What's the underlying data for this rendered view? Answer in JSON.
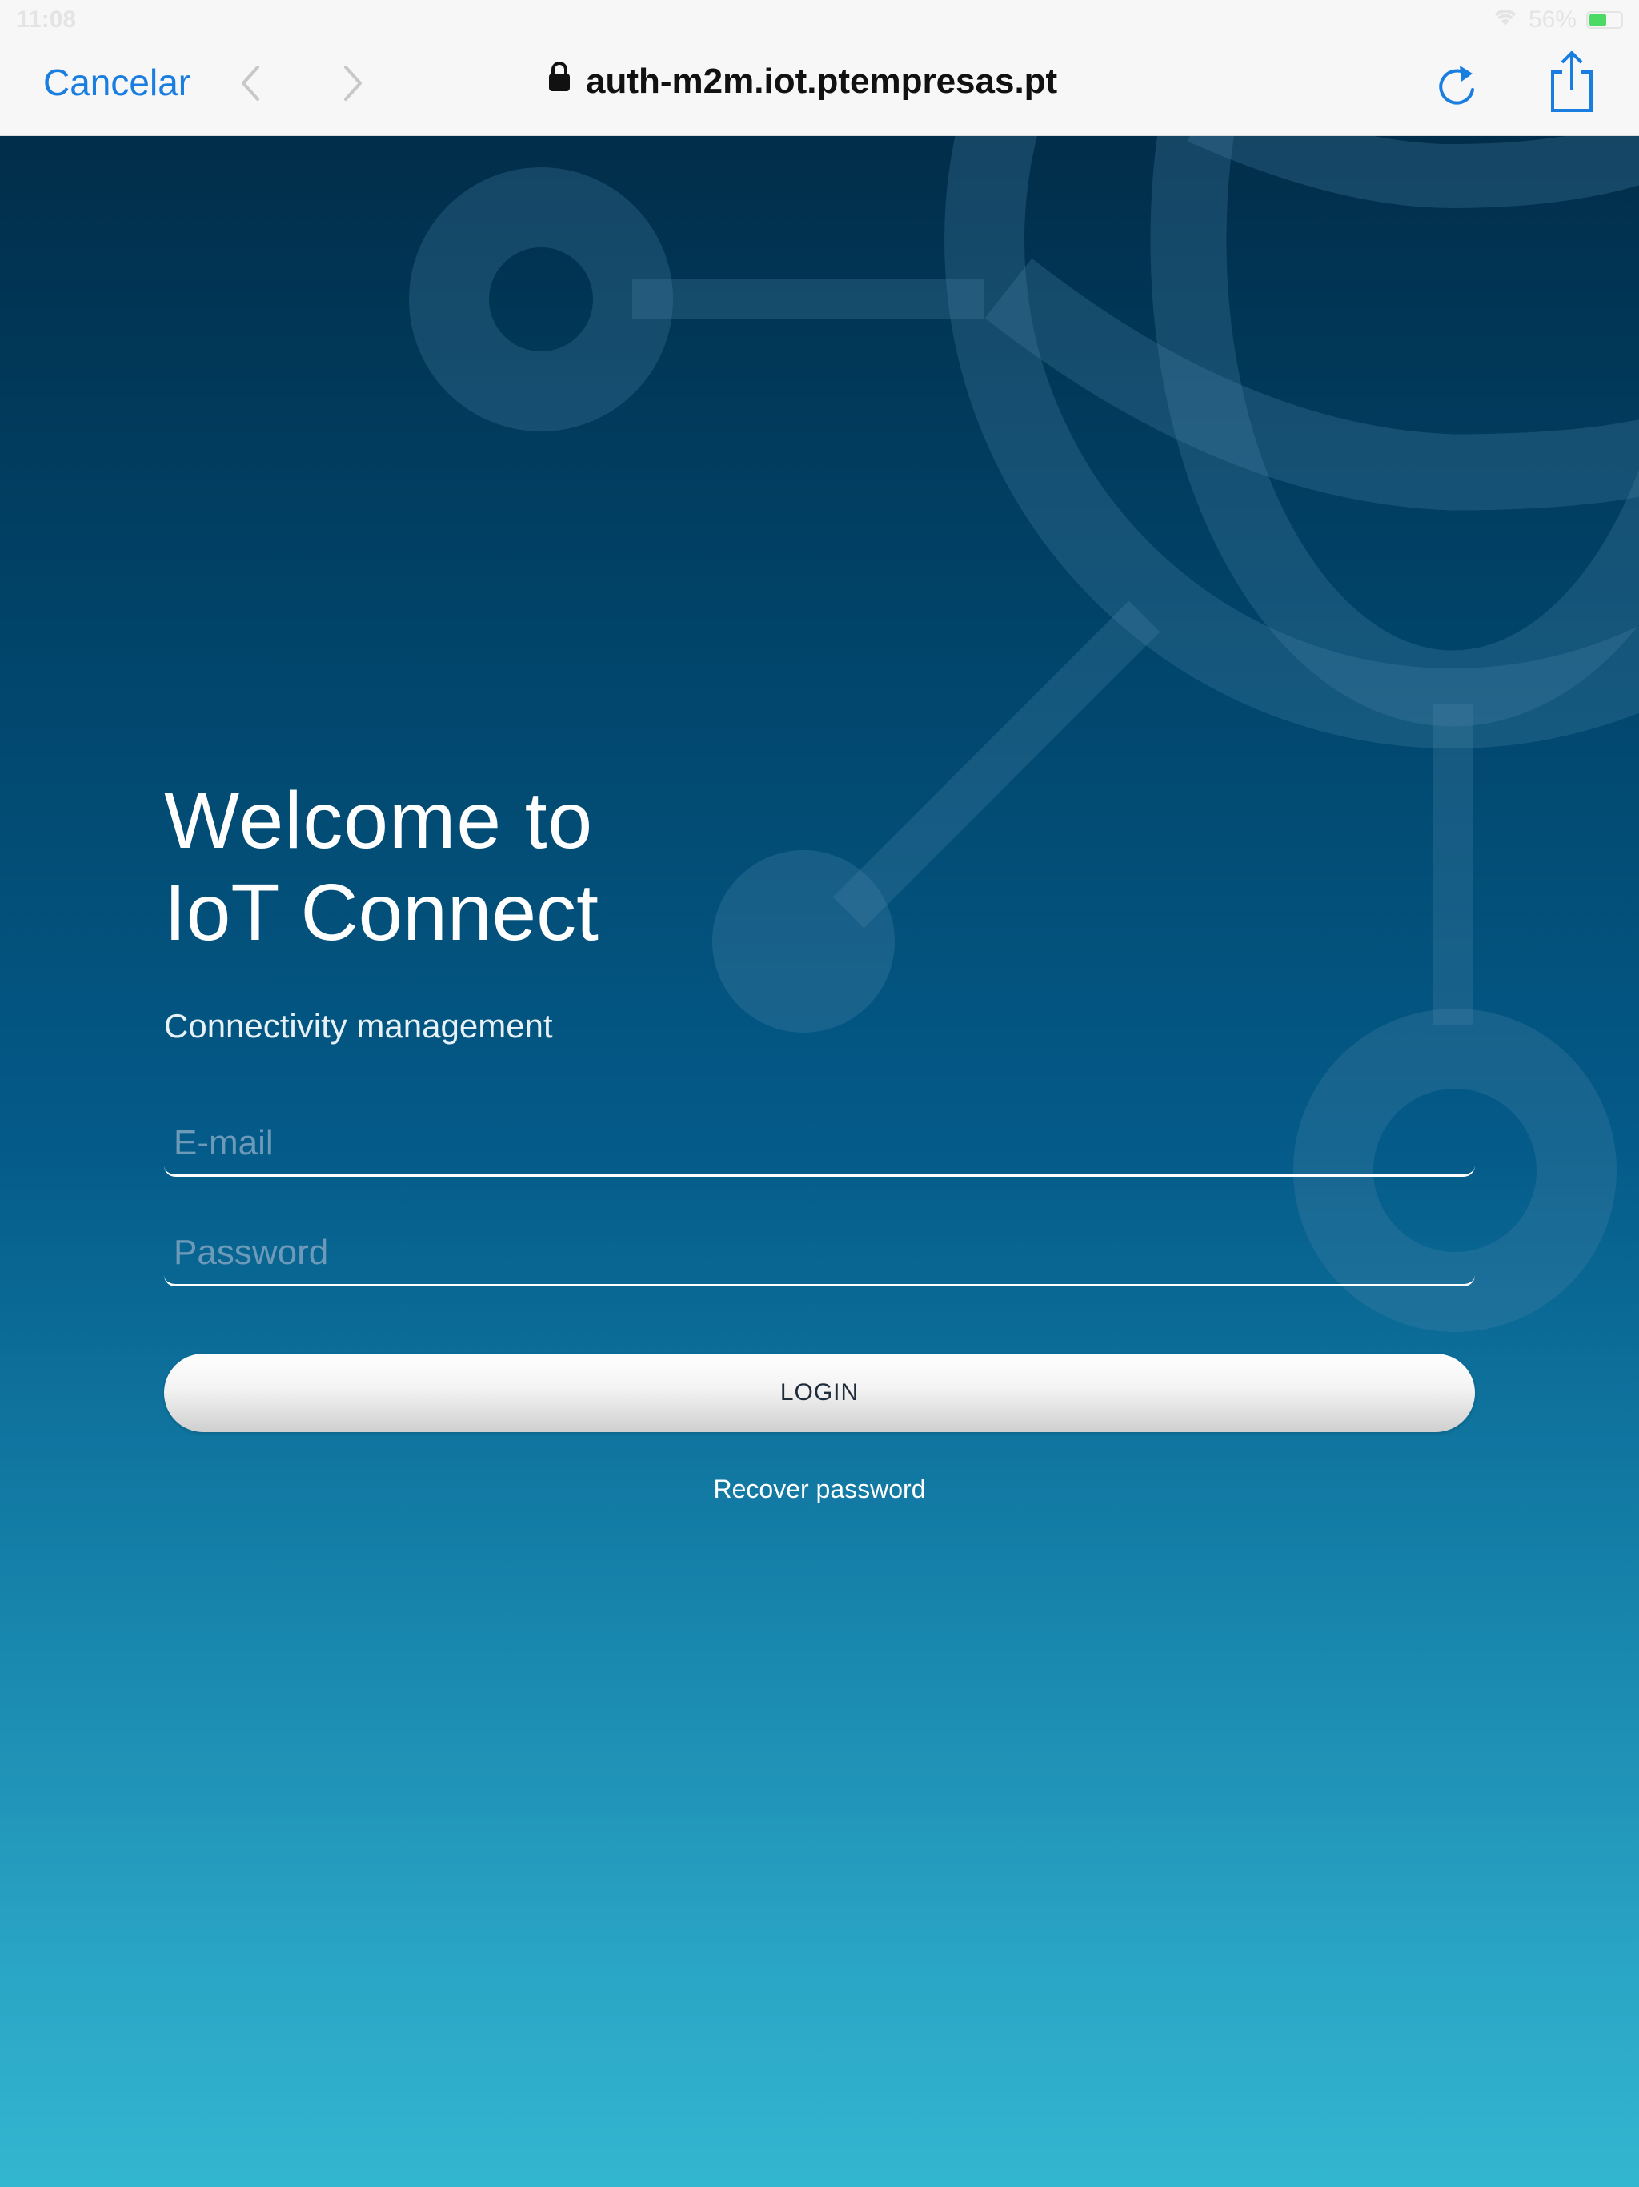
{
  "status_bar": {
    "time": "11:08",
    "battery": "56%",
    "battery_level": 0.56,
    "colors": {
      "battery_fill": "#4cd964"
    }
  },
  "browser": {
    "cancel_label": "Cancelar",
    "url": "auth-m2m.iot.ptempresas.pt",
    "icons": {
      "back": "chevron-left-icon",
      "forward": "chevron-right-icon",
      "lock": "lock-icon",
      "reload": "reload-icon",
      "share": "share-icon"
    },
    "colors": {
      "accent": "#1a7de0"
    }
  },
  "page": {
    "welcome": "Welcome to",
    "product": "IoT Connect",
    "subtitle": "Connectivity management",
    "email_placeholder": "E-mail",
    "email_value": "",
    "password_placeholder": "Password",
    "password_value": "",
    "login_label": "LOGIN",
    "recover_label": "Recover password",
    "colors": {
      "gradient_top": "#012b46",
      "gradient_bottom": "#33b6d0"
    }
  }
}
